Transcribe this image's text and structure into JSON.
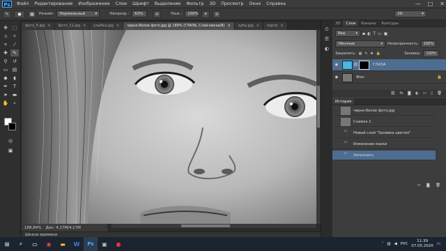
{
  "app": {
    "logo": "Ps"
  },
  "menu": [
    "Файл",
    "Редактирование",
    "Изображение",
    "Слои",
    "Шрифт",
    "Выделение",
    "Фильтр",
    "3D",
    "Просмотр",
    "Окно",
    "Справка"
  ],
  "window_controls": {
    "minimize": "—",
    "restore": "□",
    "close": "✕"
  },
  "options": {
    "mode_label": "Режим:",
    "mode_value": "Нормальный",
    "opacity_label": "Непрозр.:",
    "opacity_value": "63%",
    "flow_label": "Наж.:",
    "flow_value": "100%",
    "workspace_value": "3D"
  },
  "tabs": [
    {
      "label": "фото_6.jpg",
      "active": false
    },
    {
      "label": "фото_11.jpg",
      "active": false
    },
    {
      "label": "улыбка.jpg",
      "active": false
    },
    {
      "label": "черно-белое фото.jpg @ 189% (ГЛАЗА, Слой-маска/8)",
      "active": true
    },
    {
      "label": "зубы.jpg",
      "active": false
    },
    {
      "label": "портр",
      "active": false
    }
  ],
  "status": {
    "zoom": "188,84%",
    "doc": "Док: 4,17M/4,17M"
  },
  "timeline_label": "Шкала времени",
  "right_panel": {
    "tabs": [
      "3D",
      "Слои",
      "Каналы",
      "Контуры"
    ],
    "active_tab": "Слои",
    "kind_label": "Вид",
    "blend_mode": "Обычные",
    "opacity_label": "Непрозрачность:",
    "opacity_value": "100%",
    "lock_label": "Закрепить:",
    "fill_label": "Заливка:",
    "fill_value": "100%",
    "layers": [
      {
        "name": "ГЛАЗА",
        "selected": true
      },
      {
        "name": "Фон",
        "selected": false
      }
    ]
  },
  "history": {
    "title": "История",
    "items": [
      {
        "label": "черно-белое фото.jpg",
        "selected": false
      },
      {
        "label": "Снимок 1",
        "selected": false
      },
      {
        "label": "Новый слой \"Заливка цветом\"",
        "selected": false
      },
      {
        "label": "Изменение маски",
        "selected": false
      },
      {
        "label": "Заполнить",
        "selected": true
      }
    ]
  },
  "taskbar": {
    "lang": "РУС",
    "time": "11:39",
    "date": "07.05.2020"
  },
  "colors": {
    "accent": "#4f9fd9",
    "selected_row": "#4d6e91"
  }
}
